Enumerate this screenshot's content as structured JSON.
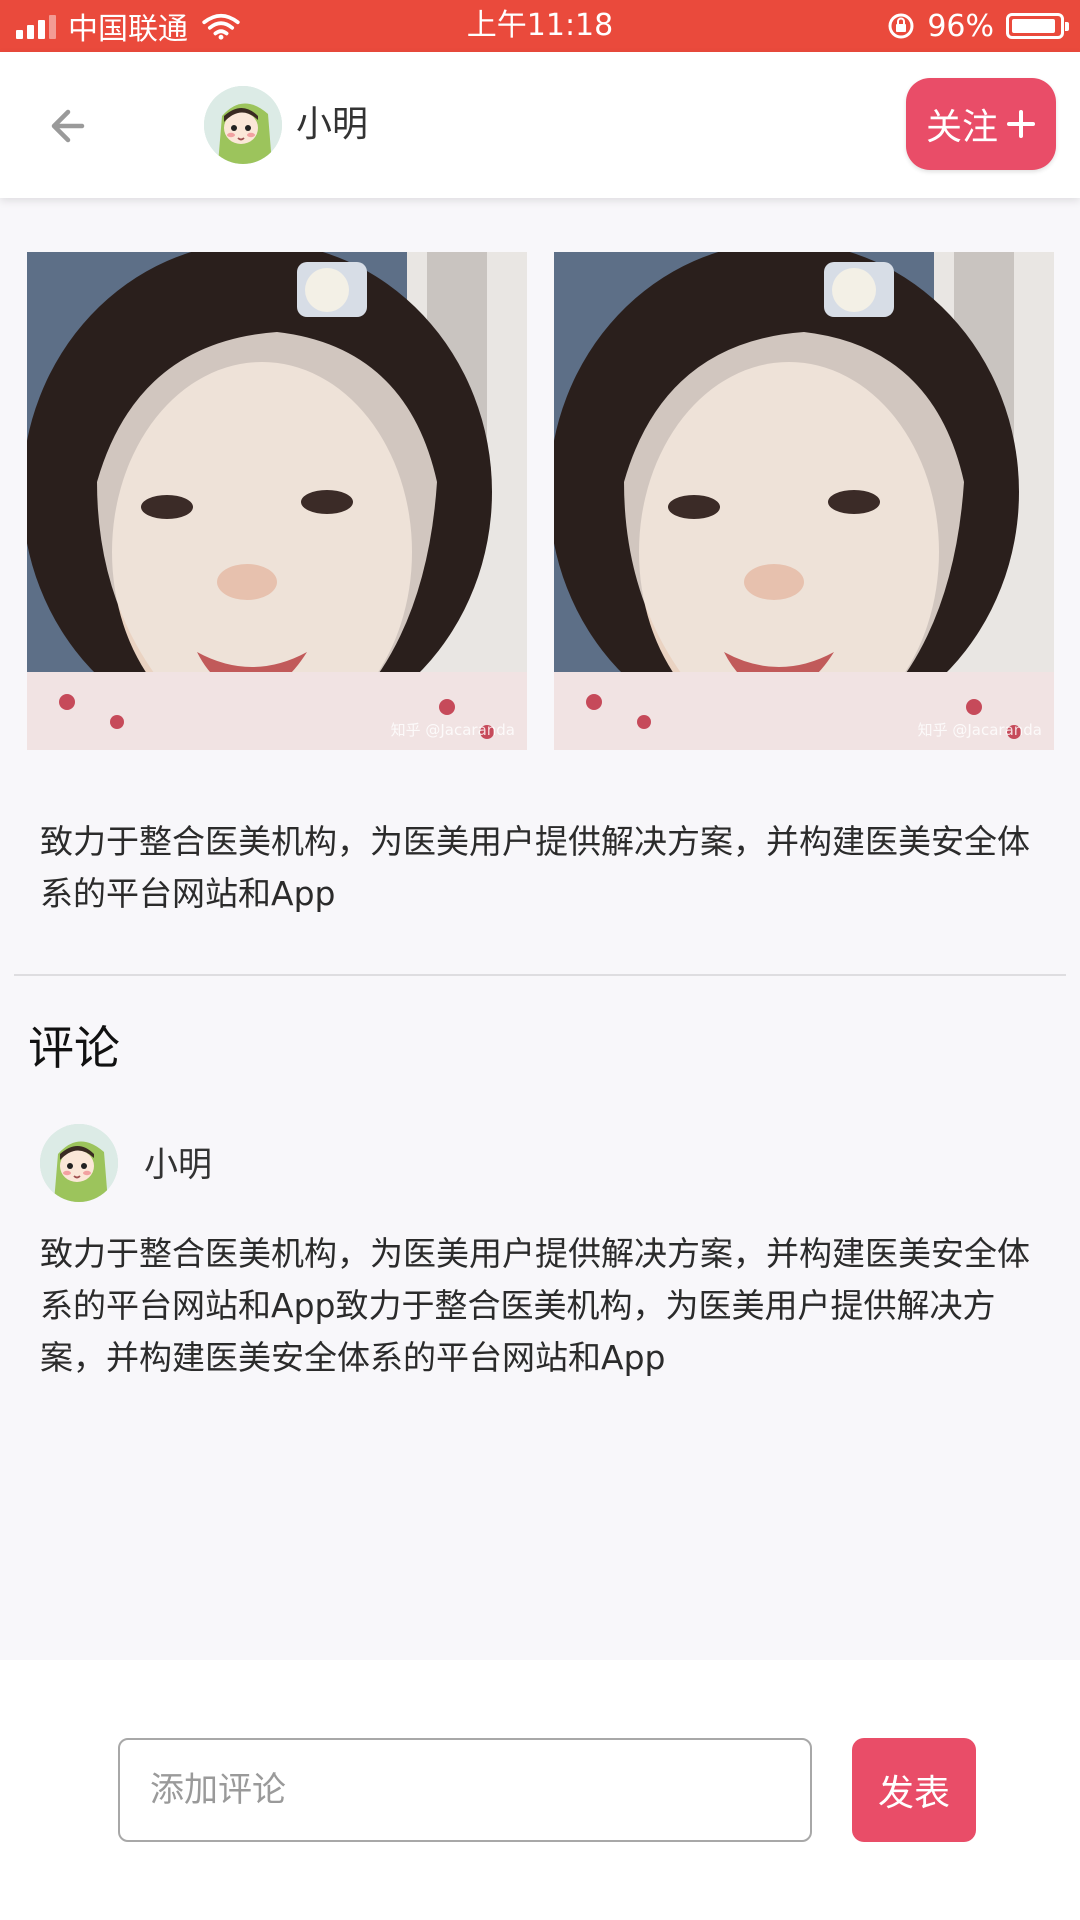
{
  "status_bar": {
    "carrier": "中国联通",
    "time": "上午11:18",
    "battery": "96%",
    "battery_level": 0.96,
    "color": "#ea4a3c"
  },
  "header": {
    "back_icon": "arrow-left-icon",
    "user_name": "小明",
    "follow_label": "关注",
    "follow_icon": "plus-icon",
    "accent": "#e94d68"
  },
  "photos": [
    {
      "watermark": "知乎 @Jacaranda"
    },
    {
      "watermark": "知乎 @Jacaranda"
    }
  ],
  "post": {
    "text": "致力于整合医美机构，为医美用户提供解决方案，并构建医美安全体系的平台网站和App"
  },
  "comments_section": {
    "title": "评论",
    "items": [
      {
        "user_name": "小明",
        "text": "致力于整合医美机构，为医美用户提供解决方案，并构建医美安全体系的平台网站和App致力于整合医美机构，为医美用户提供解决方案，并构建医美安全体系的平台网站和App"
      }
    ]
  },
  "bottom_bar": {
    "input_placeholder": "添加评论",
    "input_value": "",
    "submit_label": "发表"
  }
}
